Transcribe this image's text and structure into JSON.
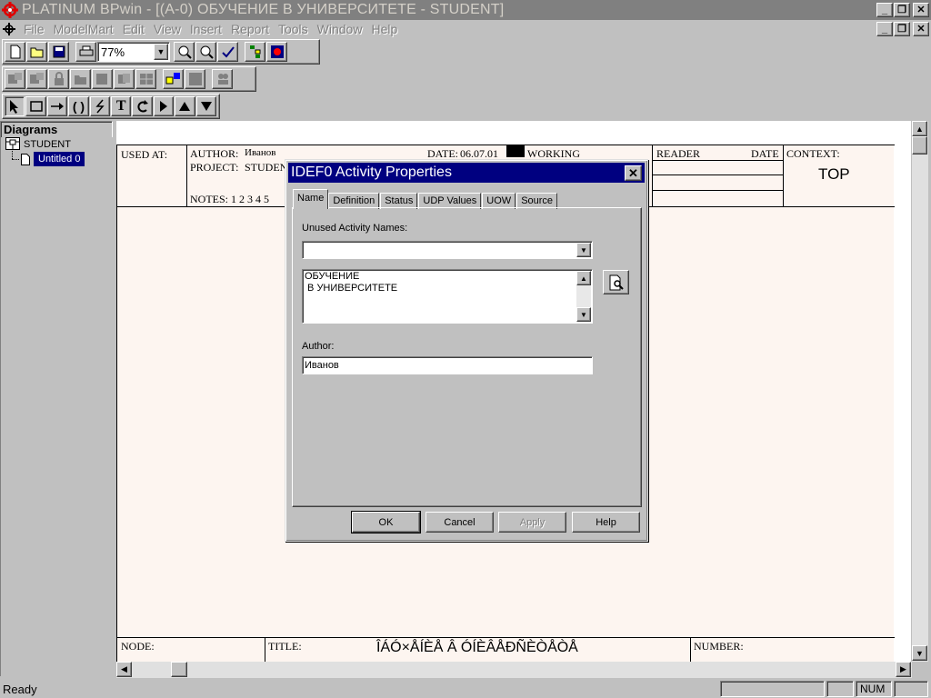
{
  "window": {
    "title": "PLATINUM BPwin - [(A-0) ОБУЧЕНИЕ  В УНИВЕРСИТЕТЕ - STUDENT]",
    "minimize": "_",
    "restore": "❐",
    "close": "✕"
  },
  "menu": {
    "items": [
      {
        "label": "File",
        "key": "F"
      },
      {
        "label": "ModelMart",
        "key": "M"
      },
      {
        "label": "Edit",
        "key": "E"
      },
      {
        "label": "View",
        "key": "V"
      },
      {
        "label": "Insert",
        "key": "I"
      },
      {
        "label": "Report",
        "key": "R"
      },
      {
        "label": "Tools",
        "key": "T"
      },
      {
        "label": "Window",
        "key": "W"
      },
      {
        "label": "Help",
        "key": "H"
      }
    ]
  },
  "toolbar": {
    "zoom_value": "77%"
  },
  "explorer": {
    "header": "Diagrams",
    "root": "STUDENT",
    "child": "Untitled 0"
  },
  "form": {
    "used_at": "USED AT:",
    "author_label": "AUTHOR:",
    "author_value": "Иванов",
    "project_label": "PROJECT:",
    "project_value": "STUDEN",
    "date_label": "DATE:",
    "date_value": "06.07.01",
    "working": "WORKING",
    "notes": "NOTES:  1  2  3  4  5",
    "reader": "READER",
    "date": "DATE",
    "context_label": "CONTEXT:",
    "context_value": "TOP",
    "node": "NODE:",
    "title_label": "TITLE:",
    "title_value": "ÎÁÓ×ÅÍÈÅ  Â ÓÍÈÂÅÐÑÈÒÅÒÅ",
    "number": "NUMBER:"
  },
  "dialog": {
    "title": "IDEF0 Activity Properties",
    "tabs": [
      "Name",
      "Definition",
      "Status",
      "UDP Values",
      "UOW",
      "Source"
    ],
    "active_tab": "Name",
    "unused_label": "Unused Activity Names:",
    "unused_value": "",
    "name_line1": "ОБУЧЕНИЕ",
    "name_line2": " В УНИВЕРСИТЕТЕ",
    "author_label": "Author:",
    "author_value": "Иванов",
    "ok": "OK",
    "cancel": "Cancel",
    "apply": "Apply",
    "help": "Help"
  },
  "status": {
    "ready": "Ready",
    "num": "NUM"
  }
}
